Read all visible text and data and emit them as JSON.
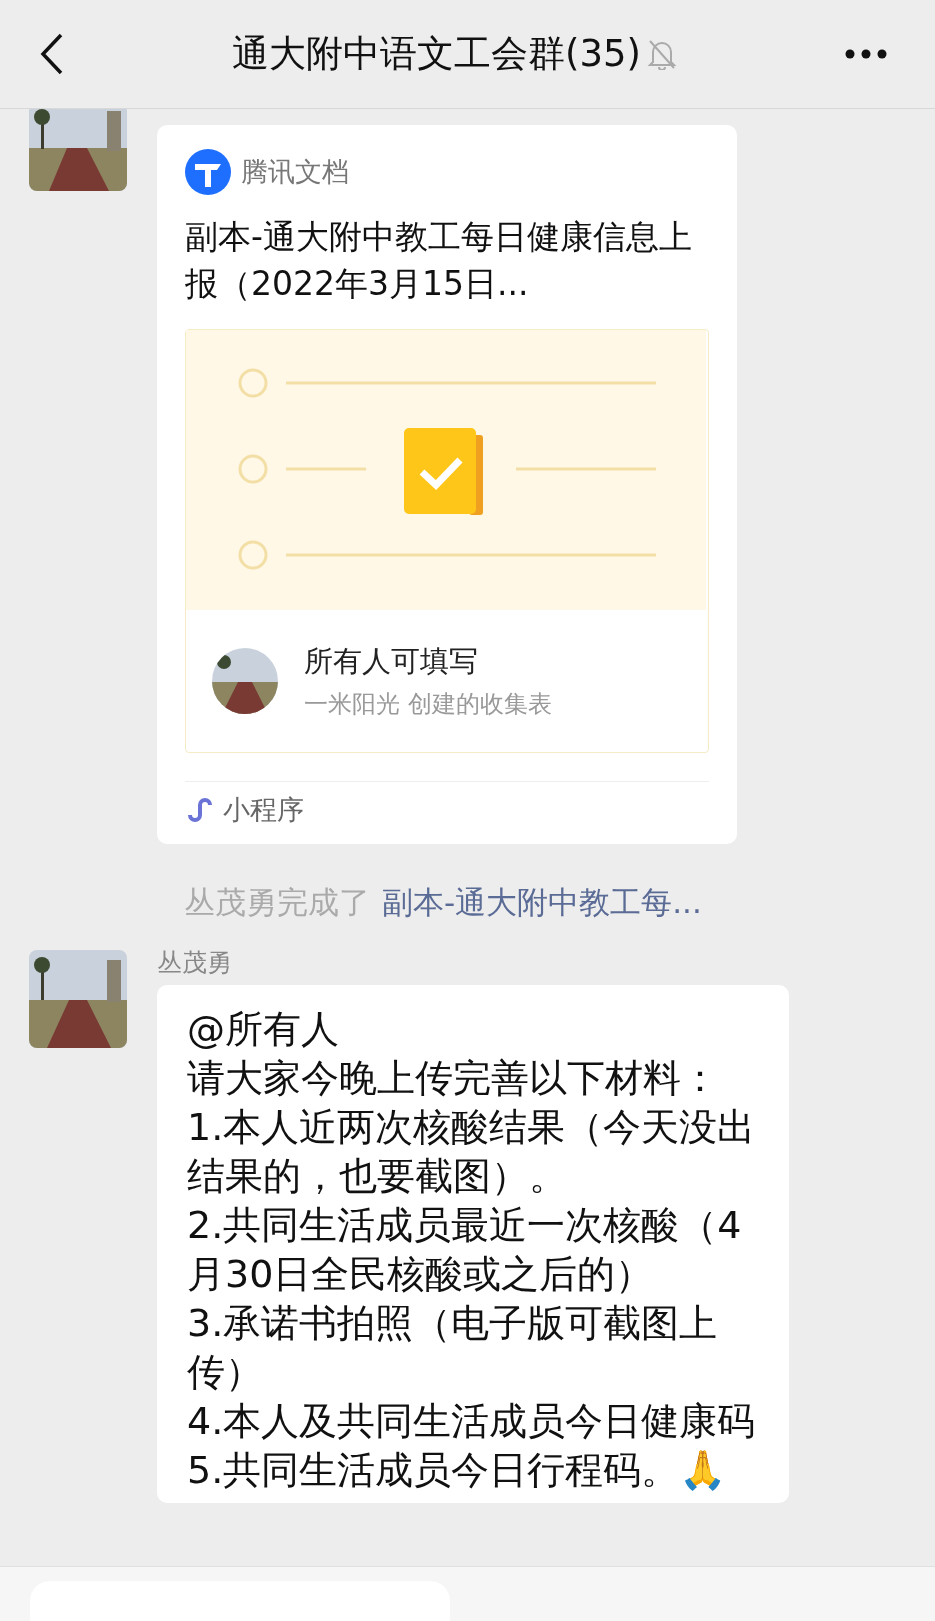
{
  "header": {
    "title": "通大附中语文工会群(35)",
    "muted": true
  },
  "messages": [
    {
      "kind": "card",
      "source": "腾讯文档",
      "title": "副本-通大附中教工每日健康信息上报（2022年3月15日...",
      "footer_title": "所有人可填写",
      "footer_subtitle": "一米阳光 创建的收集表",
      "app_label": "小程序"
    },
    {
      "kind": "system",
      "actor": "丛茂勇完成了",
      "link": "副本-通大附中教工每..."
    },
    {
      "kind": "text",
      "sender": "丛茂勇",
      "lines": [
        "@所有人",
        "请大家今晚上传完善以下材料：",
        "1.本人近两次核酸结果（今天没出结果的，也要截图）。",
        "2.共同生活成员最近一次核酸（4月30日全民核酸或之后的）",
        "3.承诺书拍照（电子版可截图上传）",
        "4.本人及共同生活成员今日健康码",
        "5.共同生活成员今日行程码。"
      ],
      "emoji": "🙏"
    }
  ]
}
